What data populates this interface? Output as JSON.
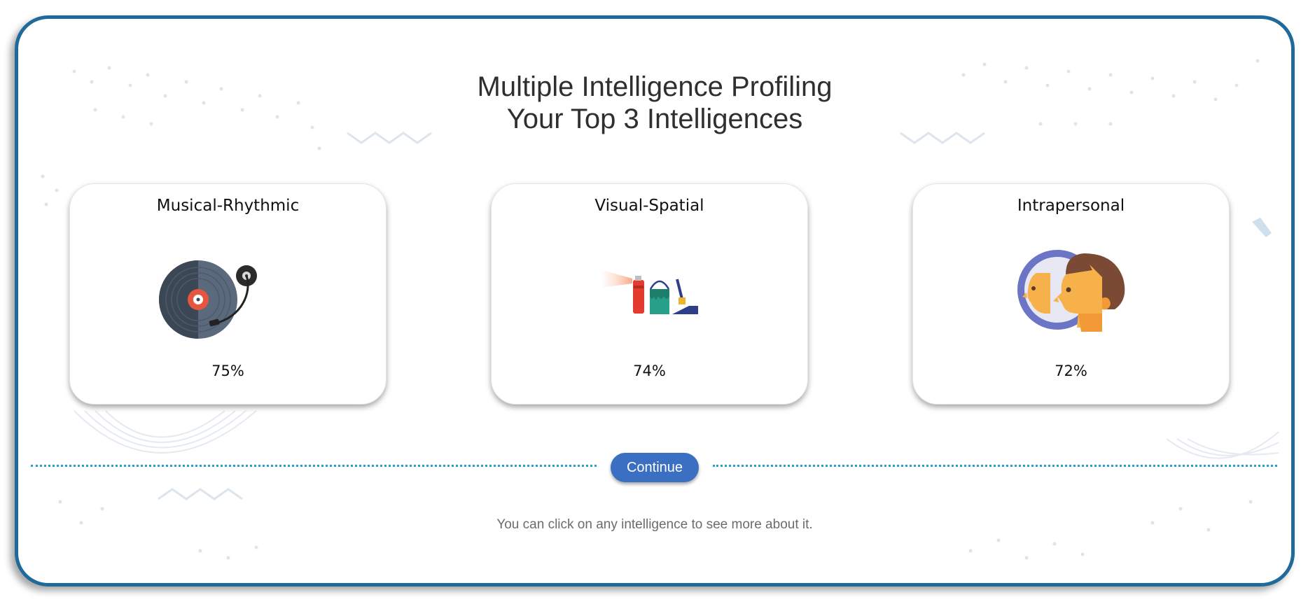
{
  "header": {
    "title_line1": "Multiple Intelligence Profiling",
    "title_line2": "Your Top 3 Intelligences"
  },
  "intelligences": [
    {
      "name": "Musical-Rhythmic",
      "percent": "75%",
      "icon": "record-player-icon"
    },
    {
      "name": "Visual-Spatial",
      "percent": "74%",
      "icon": "paint-supplies-icon"
    },
    {
      "name": "Intrapersonal",
      "percent": "72%",
      "icon": "mirror-reflection-icon"
    }
  ],
  "actions": {
    "continue_label": "Continue"
  },
  "footer": {
    "hint": "You can click on any intelligence to see more about it."
  },
  "colors": {
    "frame_border": "#1f6a9a",
    "button": "#3a6fc2",
    "divider": "#2a9fd6"
  }
}
